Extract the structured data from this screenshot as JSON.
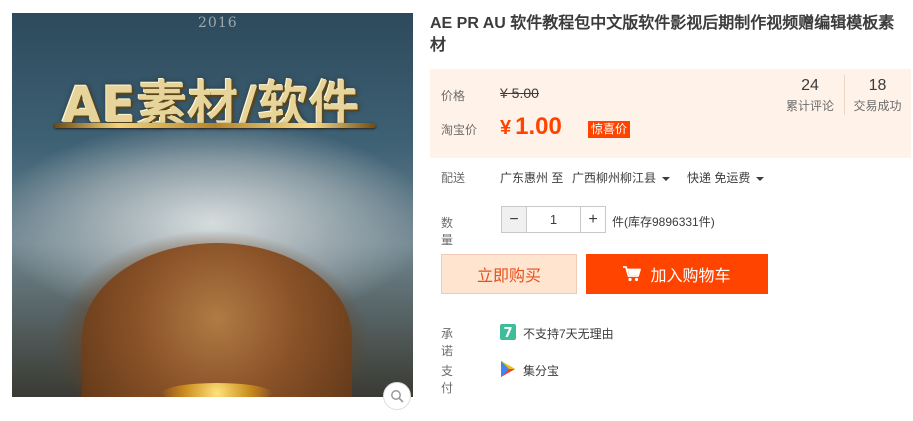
{
  "image": {
    "year_text": "2016",
    "cover_text": "AE素材/软件"
  },
  "title": "AE PR AU 软件教程包中文版软件影视后期制作视频赠编辑模板素材",
  "price": {
    "price_label": "价格",
    "original_price": "¥ 5.00",
    "taobao_label": "淘宝价",
    "currency": "¥",
    "current_price": "1.00",
    "promo_badge": "惊喜价",
    "review_count": "24",
    "review_label": "累计评论",
    "sales_count": "18",
    "sales_label": "交易成功"
  },
  "delivery": {
    "label": "配送",
    "from": "广东惠州 至",
    "to": "广西柳州柳江县",
    "method": "快递 免运费"
  },
  "quantity": {
    "label": "数量",
    "minus": "−",
    "value": "1",
    "plus": "+",
    "stock_text": "件(库存9896331件)"
  },
  "buttons": {
    "buy_now": "立即购买",
    "add_to_cart": "加入购物车"
  },
  "promise": {
    "label": "承诺",
    "icon_text": "7",
    "text": "不支持7天无理由"
  },
  "payment": {
    "label": "支付",
    "text": "集分宝"
  },
  "colors": {
    "accent": "#ff4400",
    "price_bg": "#fff2e8",
    "promise_icon": "#3fbd9a"
  }
}
